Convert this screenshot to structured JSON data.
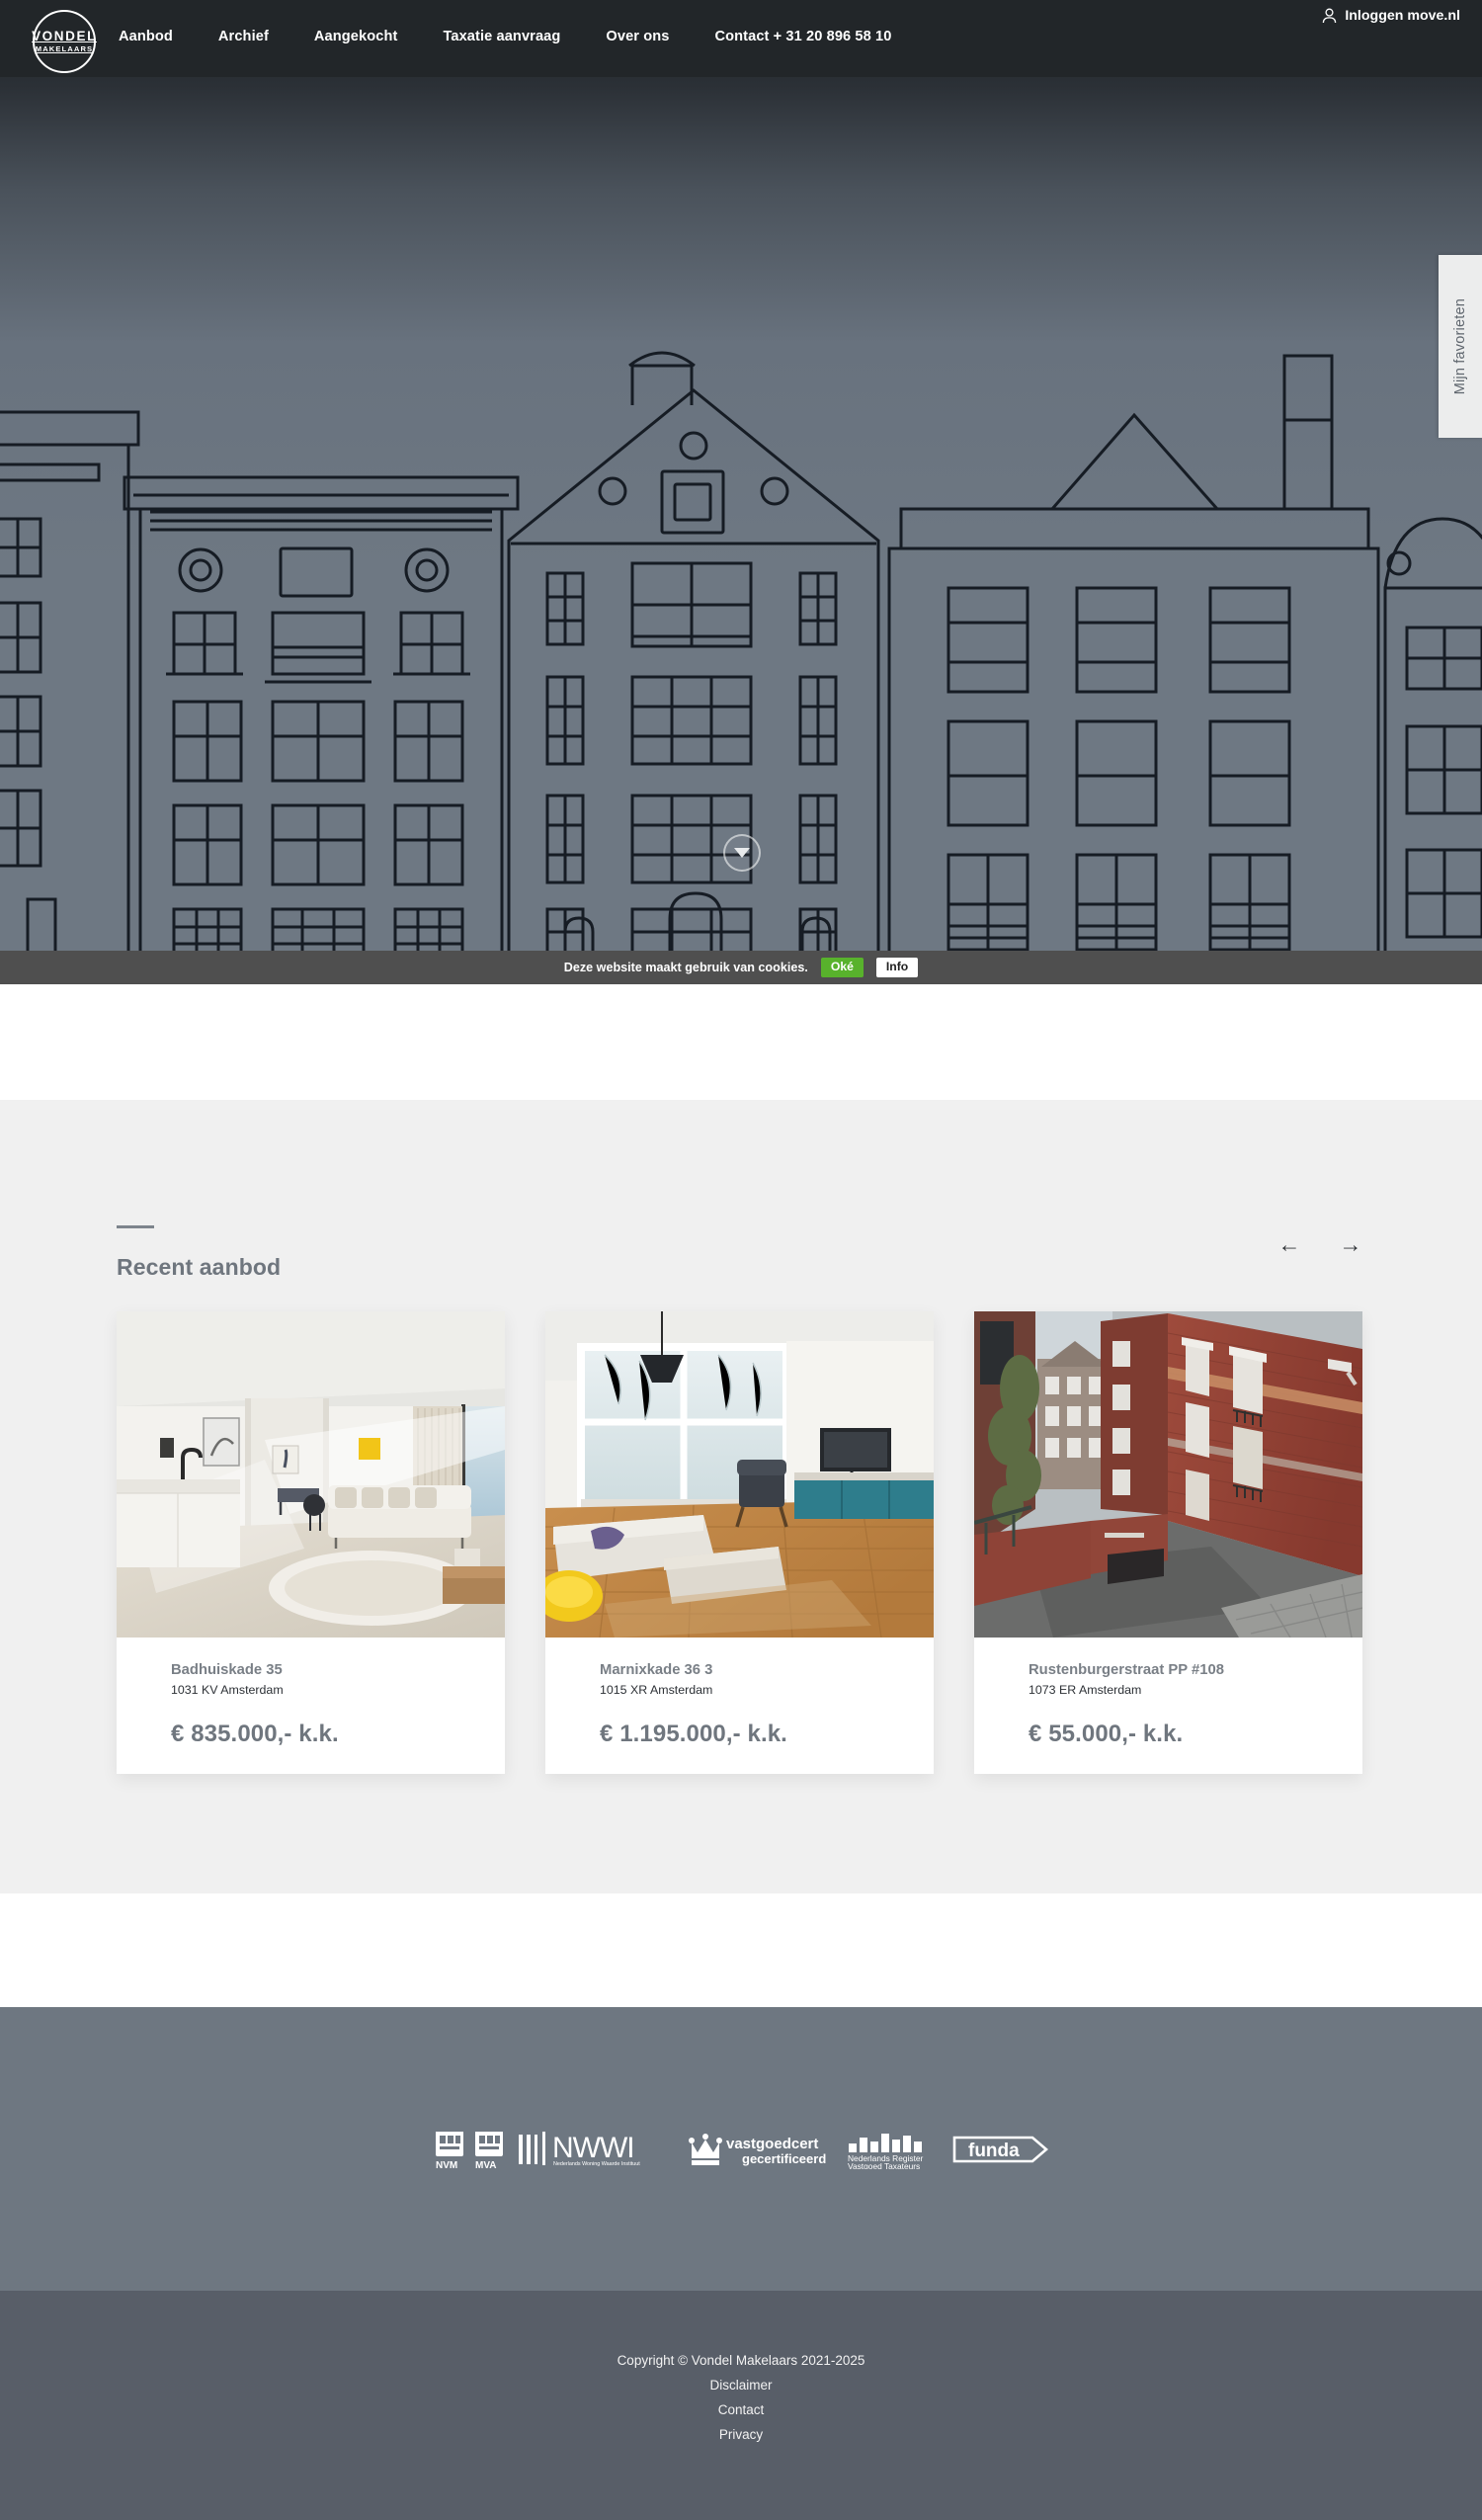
{
  "brand": {
    "logo_line1": "VONDEL",
    "logo_line2": "MAKELAARS"
  },
  "header": {
    "nav": [
      {
        "label": "Aanbod"
      },
      {
        "label": "Archief"
      },
      {
        "label": "Aangekocht"
      },
      {
        "label": "Taxatie aanvraag"
      },
      {
        "label": "Over ons"
      },
      {
        "label": "Contact + 31 20 896 58 10"
      }
    ],
    "login_label": "Inloggen move.nl",
    "login_icon": "user-icon"
  },
  "hero": {
    "favorites_tab_label": "Mijn favorieten",
    "scroll_down_icon": "chevron-down-icon",
    "background_color": "#6e7883",
    "illustration": "amsterdam-canal-houses-line-art"
  },
  "cookie_bar": {
    "message": "Deze website maakt gebruik van cookies.",
    "accept_label": "Oké",
    "info_label": "Info",
    "accept_color": "#58b22c",
    "bar_color": "#4f4f4f"
  },
  "recent": {
    "title": "Recent aanbod",
    "prev_icon": "arrow-left-icon",
    "next_icon": "arrow-right-icon",
    "prev_label": "←",
    "next_label": "→",
    "listings": [
      {
        "address": "Badhuiskade 35",
        "postcode_city": "1031 KV Amsterdam",
        "price": "€ 835.000,- k.k.",
        "photo": "bright-white-living-room"
      },
      {
        "address": "Marnixkade 36 3",
        "postcode_city": "1015 XR Amsterdam",
        "price": "€ 1.195.000,- k.k.",
        "photo": "living-room-with-wooden-floor"
      },
      {
        "address": "Rustenburgerstraat PP #108",
        "postcode_city": "1073 ER Amsterdam",
        "price": "€ 55.000,- k.k.",
        "photo": "brick-building-parking-entrance"
      }
    ]
  },
  "footer": {
    "partner_logos": [
      "NVM",
      "MVA",
      "NWWI",
      "Nederlands Woning Waarde Instituut",
      "vastgoedcert gecertificeerd",
      "Nederlands Register Vastgoed Taxateurs",
      "funda"
    ],
    "copyright": "Copyright © Vondel Makelaars 2021-2025",
    "links": [
      {
        "label": "Disclaimer"
      },
      {
        "label": "Contact"
      },
      {
        "label": "Privacy"
      }
    ]
  }
}
